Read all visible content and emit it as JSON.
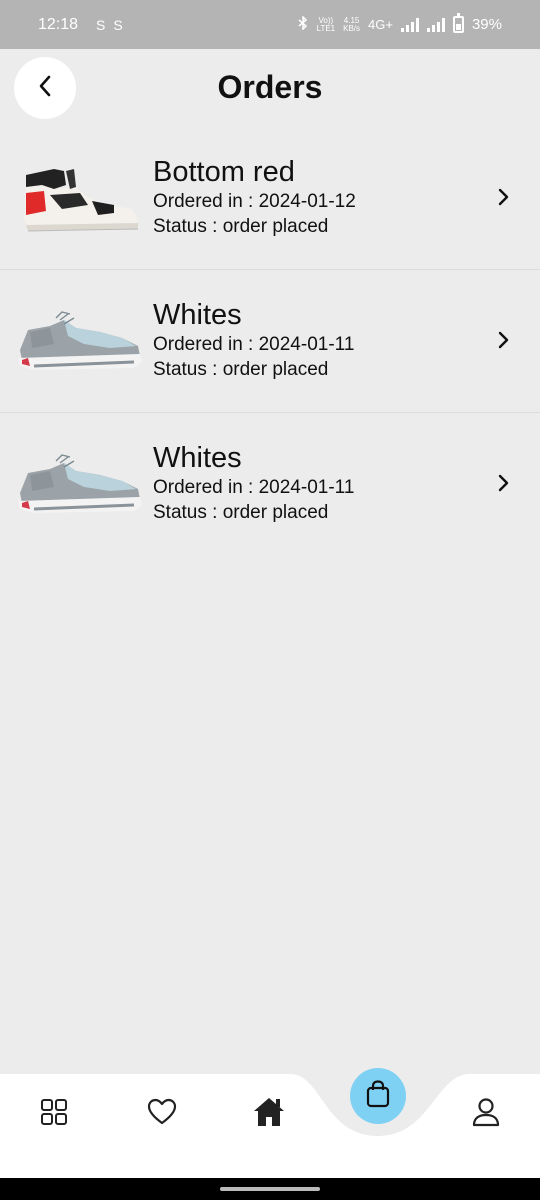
{
  "status_bar": {
    "time": "12:18",
    "left_symbols": [
      "S",
      "S"
    ],
    "network_top": "4.15",
    "network_bottom": "KB/s",
    "volte_top": "Vo))",
    "volte_bottom": "LTE1",
    "network_type": "4G+",
    "battery_percent": "39%"
  },
  "header": {
    "title": "Orders",
    "back_icon": "chevron-left-icon"
  },
  "orders": [
    {
      "name": "Bottom red",
      "ordered_in": "Ordered in : 2024-01-12",
      "status": "Status : order placed",
      "image": "high-top-sneaker-red-black",
      "icon": "chevron-right-icon"
    },
    {
      "name": "Whites",
      "ordered_in": "Ordered in : 2024-01-11",
      "status": "Status : order placed",
      "image": "running-shoe-grey-blue",
      "icon": "chevron-right-icon"
    },
    {
      "name": "Whites",
      "ordered_in": "Ordered in : 2024-01-11",
      "status": "Status : order placed",
      "image": "running-shoe-grey-blue",
      "icon": "chevron-right-icon"
    }
  ],
  "bottom_nav": {
    "items": [
      "grid-icon",
      "heart-icon",
      "home-icon",
      "shopping-bag-icon",
      "user-icon"
    ],
    "active": "shopping-bag-icon",
    "active_color": "#7fd1f4"
  }
}
